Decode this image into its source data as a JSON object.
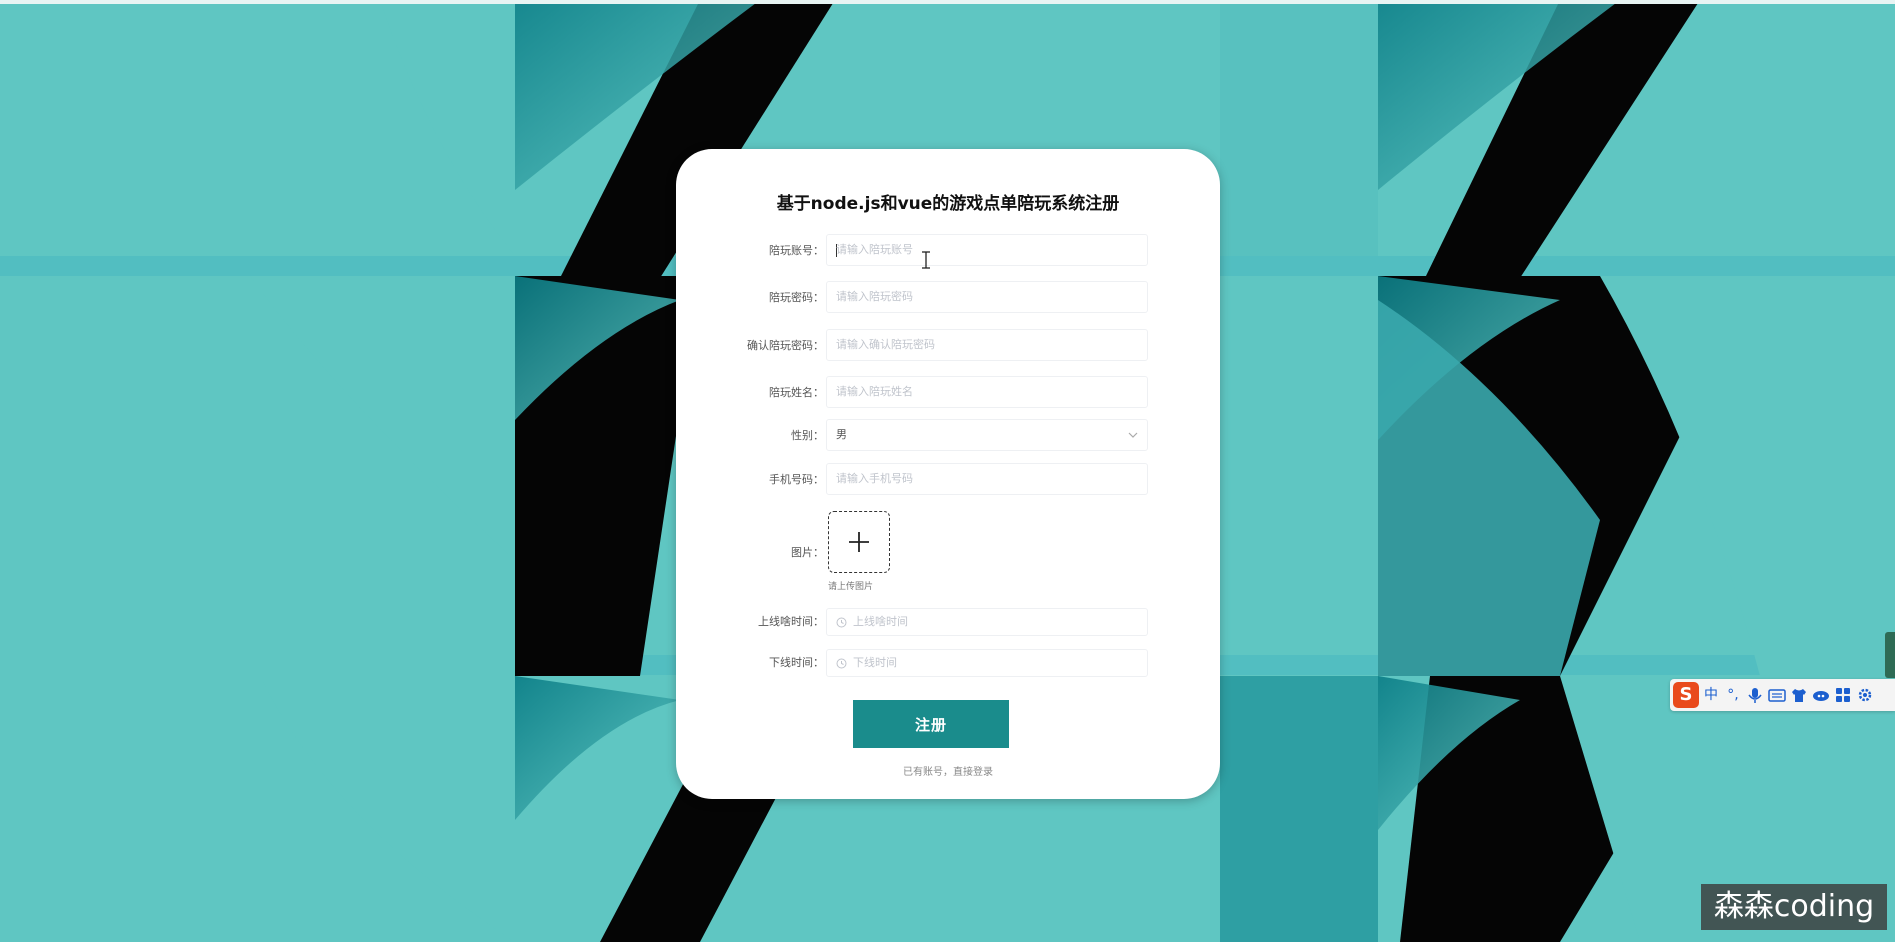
{
  "form": {
    "title": "基于node.js和vue的游戏点单陪玩系统注册",
    "fields": [
      {
        "label": "陪玩账号：",
        "placeholder": "请输入陪玩账号"
      },
      {
        "label": "陪玩密码：",
        "placeholder": "请输入陪玩密码"
      },
      {
        "label": "确认陪玩密码：",
        "placeholder": "请输入确认陪玩密码"
      },
      {
        "label": "陪玩姓名：",
        "placeholder": "请输入陪玩姓名"
      },
      {
        "label": "性别：",
        "value": "男"
      },
      {
        "label": "手机号码：",
        "placeholder": "请输入手机号码"
      },
      {
        "label": "图片：",
        "hint": "请上传图片"
      },
      {
        "label": "上线啥时间：",
        "placeholder": "上线啥时间"
      },
      {
        "label": "下线时间：",
        "placeholder": "下线时间"
      }
    ],
    "submit_label": "注册",
    "login_link": "已有账号，直接登录"
  },
  "ime": {
    "logo": "S",
    "mode": "中",
    "punct": "°,",
    "icons": [
      "microphone-icon",
      "keyboard-icon",
      "shirt-icon",
      "cloud-icon",
      "apps-icon",
      "settings-icon"
    ]
  },
  "watermark": "森森coding",
  "colors": {
    "background": "#5fc6c2",
    "button": "#1a8c8c",
    "ime_logo": "#e94a1c"
  }
}
